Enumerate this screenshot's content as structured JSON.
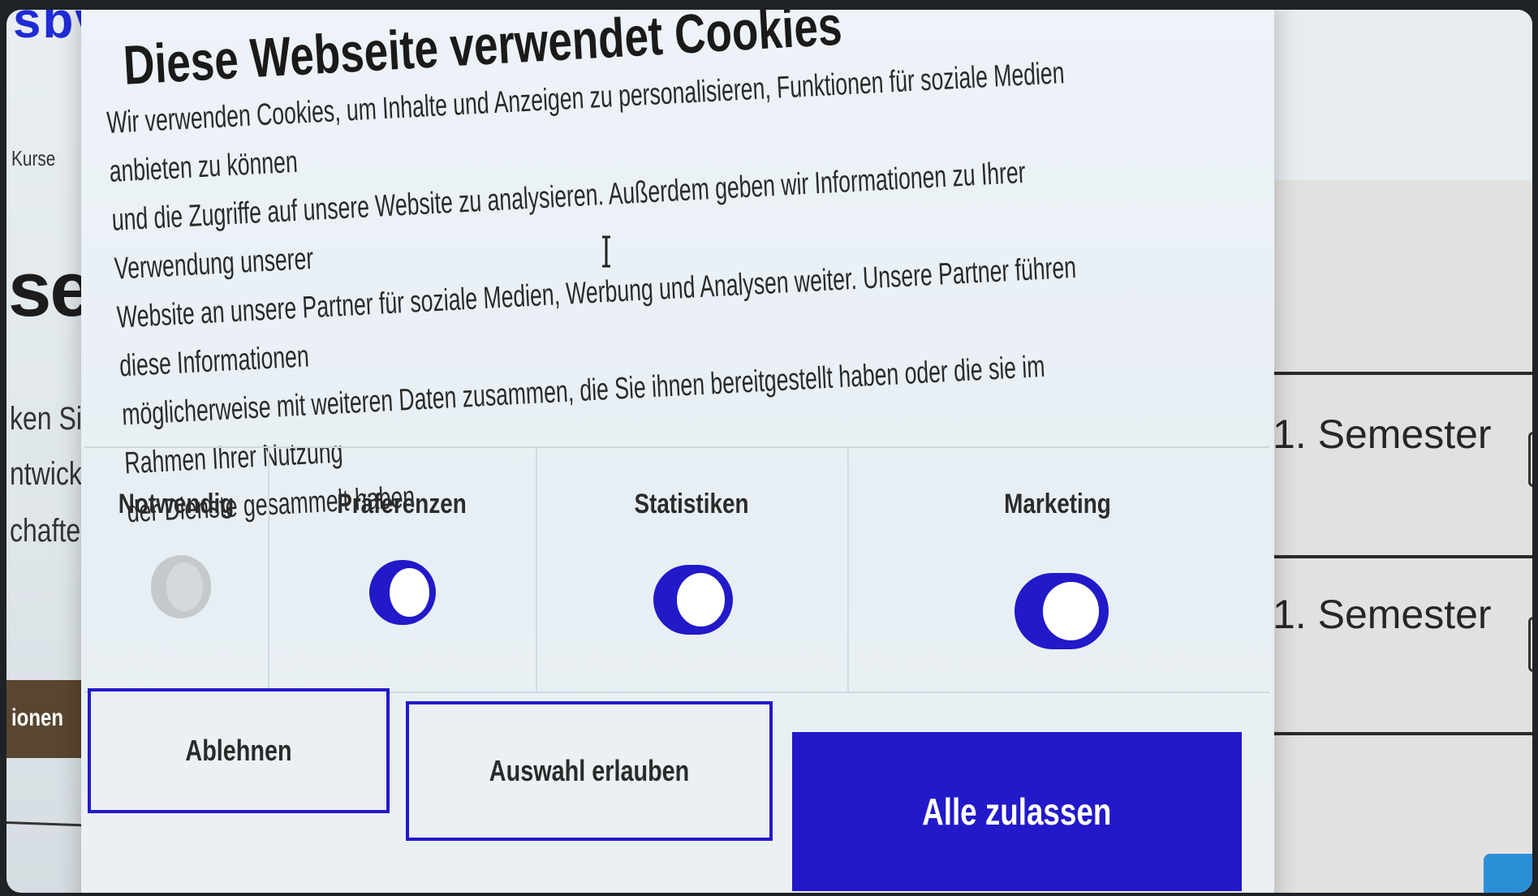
{
  "background": {
    "logo": "sbv",
    "nav_item": "Kurse",
    "big_heading": "ser",
    "lines": [
      "ken Sie d",
      "ntwicklu",
      "chaften"
    ],
    "side_button": "ionen",
    "semesters": [
      "1. Semester",
      "1. Semester"
    ]
  },
  "cookie_dialog": {
    "title": "Diese Webseite verwendet Cookies",
    "text_lines": [
      "Wir verwenden Cookies, um Inhalte und Anzeigen zu personalisieren, Funktionen für soziale Medien anbieten zu können",
      "und die Zugriffe auf unsere Website zu analysieren. Außerdem geben wir Informationen zu Ihrer Verwendung unserer",
      "Website an unsere Partner für soziale Medien, Werbung und Analysen weiter. Unsere Partner führen diese Informationen",
      "möglicherweise mit weiteren Daten zusammen, die Sie ihnen bereitgestellt haben oder die sie im Rahmen Ihrer Nutzung",
      "der Dienste gesammelt haben."
    ],
    "categories": [
      {
        "label": "Notwendig",
        "enabled": true,
        "locked": true
      },
      {
        "label": "Präferenzen",
        "enabled": true,
        "locked": false
      },
      {
        "label": "Statistiken",
        "enabled": true,
        "locked": false
      },
      {
        "label": "Marketing",
        "enabled": true,
        "locked": false
      }
    ],
    "buttons": {
      "deny": "Ablehnen",
      "allow_selection": "Auswahl erlauben",
      "allow_all": "Alle zulassen"
    },
    "accent_color": "#2219c9"
  }
}
